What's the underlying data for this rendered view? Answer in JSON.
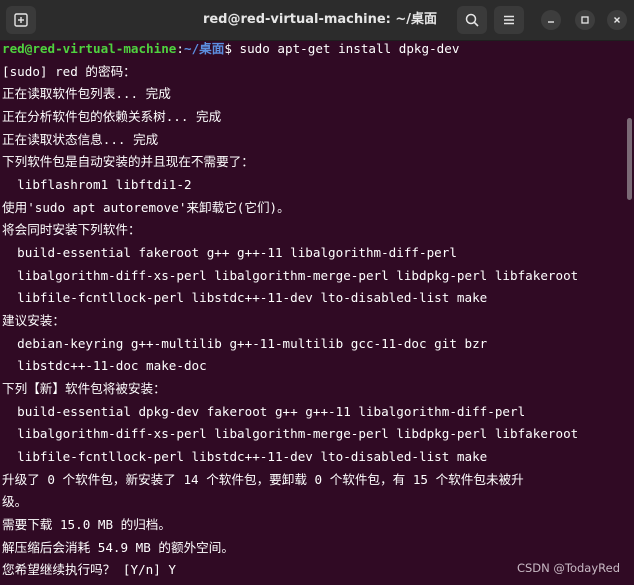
{
  "window": {
    "title": "red@red-virtual-machine: ~/桌面"
  },
  "prompt": {
    "user_host": "red@red-virtual-machine",
    "separator": ":",
    "path": "~/桌面",
    "symbol": "$",
    "command": " sudo apt-get install dpkg-dev"
  },
  "output_lines": [
    "[sudo] red 的密码：",
    "正在读取软件包列表... 完成",
    "正在分析软件包的依赖关系树... 完成",
    "正在读取状态信息... 完成",
    "下列软件包是自动安装的并且现在不需要了：",
    "  libflashrom1 libftdi1-2",
    "使用'sudo apt autoremove'来卸载它(它们)。",
    "将会同时安装下列软件：",
    "  build-essential fakeroot g++ g++-11 libalgorithm-diff-perl",
    "  libalgorithm-diff-xs-perl libalgorithm-merge-perl libdpkg-perl libfakeroot",
    "  libfile-fcntllock-perl libstdc++-11-dev lto-disabled-list make",
    "建议安装：",
    "  debian-keyring g++-multilib g++-11-multilib gcc-11-doc git bzr",
    "  libstdc++-11-doc make-doc",
    "下列【新】软件包将被安装：",
    "  build-essential dpkg-dev fakeroot g++ g++-11 libalgorithm-diff-perl",
    "  libalgorithm-diff-xs-perl libalgorithm-merge-perl libdpkg-perl libfakeroot",
    "  libfile-fcntllock-perl libstdc++-11-dev lto-disabled-list make",
    "升级了 0 个软件包，新安装了 14 个软件包，要卸载 0 个软件包，有 15 个软件包未被升",
    "级。",
    "需要下载 15.0 MB 的归档。",
    "解压缩后会消耗 54.9 MB 的额外空间。",
    "您希望继续执行吗？ [Y/n] Y"
  ],
  "watermark": "CSDN @TodayRed",
  "colors": {
    "terminal_bg": "#300a24",
    "prompt_user": "#4fd23f",
    "prompt_path": "#5c8fe0",
    "text": "#ffffff"
  }
}
